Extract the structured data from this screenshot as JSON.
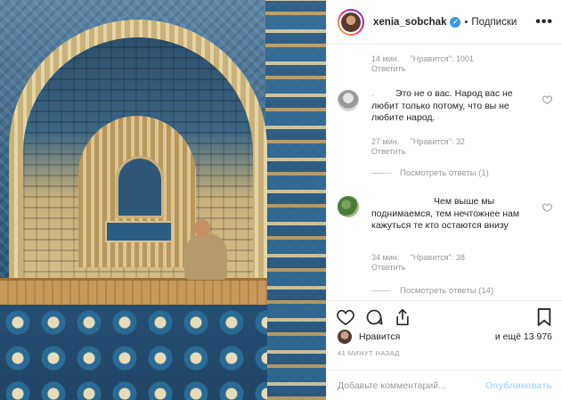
{
  "header": {
    "username": "xenia_sobchak",
    "verified_icon": "verified-check-icon",
    "separator": "•",
    "follow_label": "Подписки",
    "more_icon": "more-horizontal-icon",
    "more_glyph": "•••"
  },
  "comments_top_meta": {
    "time": "14 мин.",
    "likes": "\"Нравится\": 1001",
    "reply": "Ответить"
  },
  "comments": [
    {
      "username": ".",
      "text": "Это не о вас. Народ вас не любит только потому, что вы не любите народ.",
      "time": "27 мин.",
      "likes": "\"Нравится\": 32",
      "reply": "Ответить",
      "view_replies": "Посмотреть ответы (1)"
    },
    {
      "username": "",
      "text": "Чем выше мы поднимаемся, тем нечтожнее нам кажуться те кто остаются внизу",
      "time": "34 мин.",
      "likes": "\"Нравится\": 38",
      "reply": "Ответить",
      "view_replies": "Посмотреть ответы (14)"
    }
  ],
  "actions": {
    "like_icon": "heart-icon",
    "comment_icon": "comment-icon",
    "share_icon": "share-icon",
    "save_icon": "bookmark-icon"
  },
  "likes": {
    "label": "Нравится",
    "more": "и ещё 13 976"
  },
  "time_ago": "41 МИНУТ НАЗАД",
  "add_comment": {
    "placeholder": "Добавьте комментарий...",
    "publish_label": "Опубликовать"
  },
  "colors": {
    "verified": "#3897f0",
    "publish_disabled": "#b3dbff",
    "muted_text": "#999999"
  }
}
